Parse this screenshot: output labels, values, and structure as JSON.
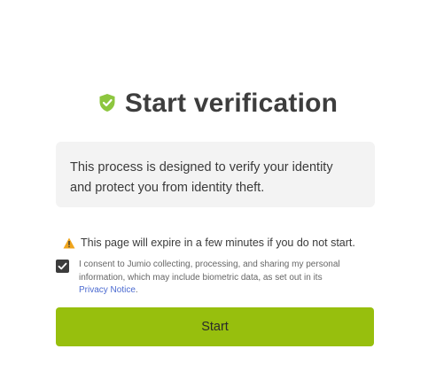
{
  "header": {
    "title": "Start verification",
    "icon": "shield-check-icon",
    "icon_color": "#8dc63f"
  },
  "info": {
    "text_line1": "This process is designed to verify your identity",
    "text_line2": "and protect you from identity theft."
  },
  "warning": {
    "icon": "warning-icon",
    "text": "This page will expire in a few minutes if you do not start."
  },
  "consent": {
    "checked": true,
    "text_line1": "I consent to Jumio collecting, processing, and sharing my personal",
    "text_line2": "information, which may include biometric data, as set out in its",
    "link_text": "Privacy Notice",
    "link_suffix": "."
  },
  "actions": {
    "start_label": "Start",
    "button_color": "#97bf0d"
  }
}
